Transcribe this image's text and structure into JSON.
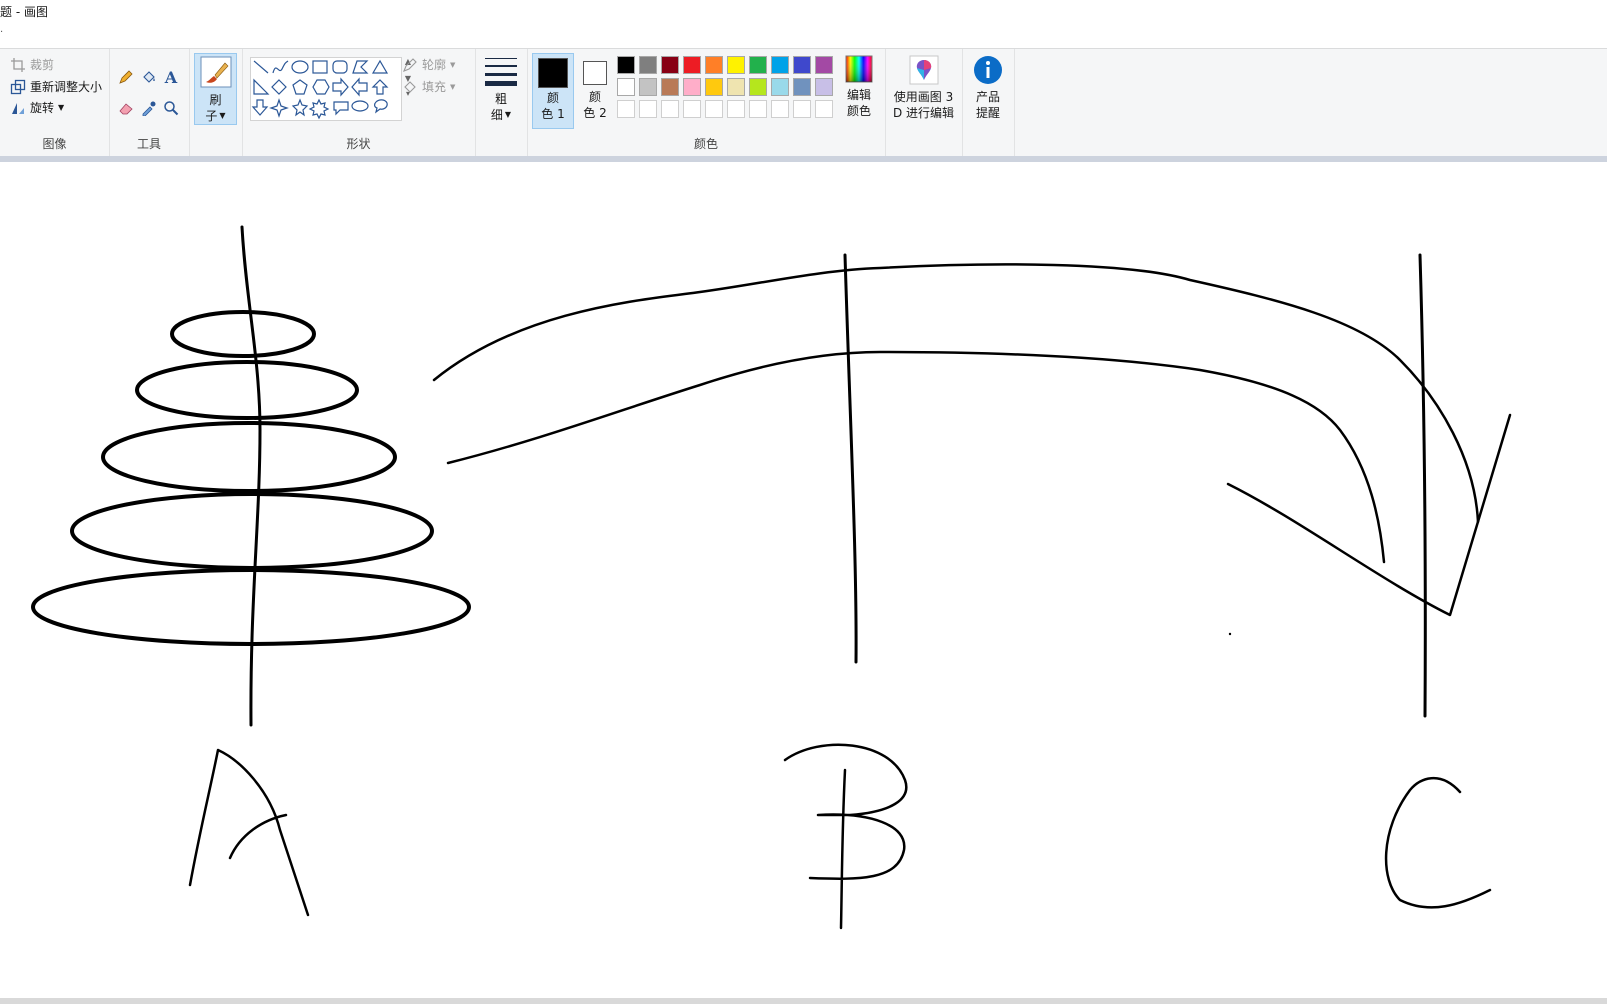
{
  "window": {
    "title": "题 - 画图",
    "subtitle": "."
  },
  "ribbon": {
    "image_group": {
      "label": "图像",
      "crop": "裁剪",
      "resize": "重新调整大小",
      "rotate": "旋转"
    },
    "tools_group": {
      "label": "工具",
      "text_tool": "A"
    },
    "brush": {
      "line1": "刷",
      "line2": "子"
    },
    "shapes_group": {
      "label": "形状",
      "outline": "轮廓",
      "fill": "填充"
    },
    "size": {
      "line1": "粗",
      "line2": "细"
    },
    "colors_group": {
      "label": "颜色",
      "color1": {
        "line1": "颜",
        "line2": "色 1",
        "value": "#000000"
      },
      "color2": {
        "line1": "颜",
        "line2": "色 2",
        "value": "#ffffff"
      },
      "edit_colors": {
        "line1": "编辑",
        "line2": "颜色"
      },
      "palette_row1": [
        "#000000",
        "#7f7f7f",
        "#880015",
        "#ed1c24",
        "#ff7f27",
        "#fff200",
        "#22b14c",
        "#00a2e8",
        "#3f48cc",
        "#a349a4"
      ],
      "palette_row2": [
        "#ffffff",
        "#c3c3c3",
        "#b97a57",
        "#ffaec9",
        "#ffc90e",
        "#efe4b0",
        "#b5e61d",
        "#99d9ea",
        "#7092be",
        "#c8bfe7"
      ]
    },
    "paint3d": {
      "line1": "使用画图 3",
      "line2": "D 进行编辑"
    },
    "tips": {
      "line1": "产品",
      "line2": "提醒"
    }
  },
  "canvas": {
    "labels": {
      "a": "A",
      "b": "B",
      "c": "C"
    },
    "stroke_color": "#000000"
  }
}
